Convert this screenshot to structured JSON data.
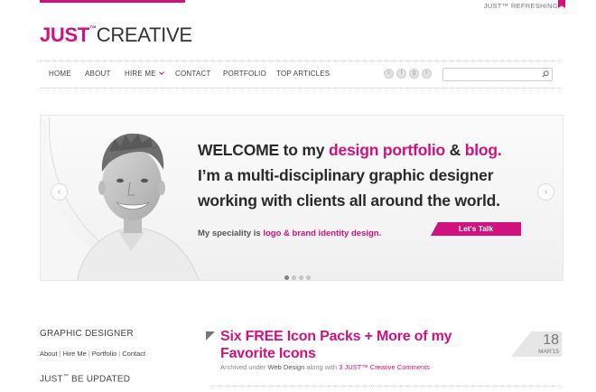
{
  "header": {
    "tagline": "JUST™ REFRESHING",
    "logo_just": "JUST",
    "logo_tm": "™",
    "logo_creative": "CREATIVE"
  },
  "nav": {
    "items": [
      "HOME",
      "ABOUT",
      "HIRE ME",
      "CONTACT",
      "PORTFOLIO",
      "TOP ARTICLES"
    ],
    "social_icons": [
      "twitter-icon",
      "facebook-icon",
      "google-plus-icon",
      "rss-icon"
    ],
    "social_glyphs": [
      "t",
      "f",
      "g",
      "r"
    ],
    "search_placeholder": ""
  },
  "hero": {
    "line1_a": "WELCOME to my ",
    "line1_b": "design portfolio",
    "line1_c": " & ",
    "line1_d": "blog.",
    "line2": "I’m a multi-disciplinary graphic designer",
    "line3": "working with clients all around the world.",
    "speciality_a": "My speciality is ",
    "speciality_b": "logo & brand identity design",
    "speciality_c": ".",
    "cta": "Let's Talk",
    "prev": "‹",
    "next": "›",
    "slide_count": 4,
    "active_slide": 1
  },
  "sidebar": {
    "title": "GRAPHIC DESIGNER",
    "links": [
      "About",
      "Hire Me",
      "Portfolio",
      "Contact"
    ],
    "sep": "|",
    "title2": "JUST",
    "title2_tm": "™",
    "title2_rest": " BE UPDATED"
  },
  "post": {
    "title": "Six FREE Icon Packs + More of my Favorite Icons",
    "meta_a": "Archived under ",
    "meta_category": "Web Design",
    "meta_b": " along with ",
    "meta_comments": "3 JUST™ Creative Comments",
    "date_day": "18",
    "date_month": "MAR'15"
  },
  "colors": {
    "accent": "#d1127e",
    "text": "#333333"
  }
}
